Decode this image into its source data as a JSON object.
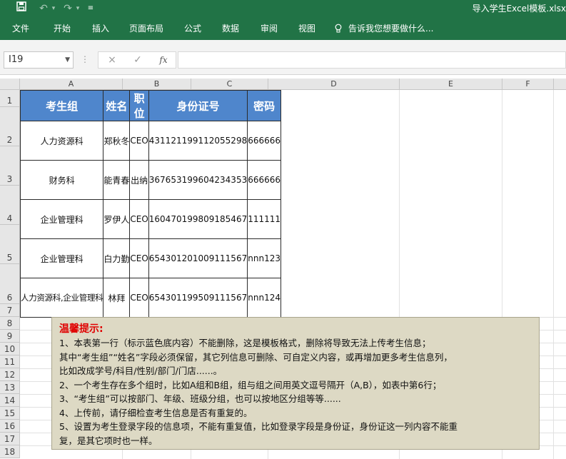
{
  "window": {
    "title": "导入学生Excel模板.xlsx"
  },
  "quick_access": {
    "icons": [
      "save-icon",
      "undo-icon",
      "redo-icon",
      "customize-icon"
    ]
  },
  "ribbon": {
    "tabs": [
      "文件",
      "开始",
      "插入",
      "页面布局",
      "公式",
      "数据",
      "审阅",
      "视图"
    ],
    "tell_me": "告诉我您想要做什么..."
  },
  "formula_bar": {
    "name_box": "I19",
    "cancel": "×",
    "enter": "✓",
    "fx": "fx",
    "value": ""
  },
  "columns": [
    "A",
    "B",
    "C",
    "D",
    "E",
    "F"
  ],
  "rows": [
    "1",
    "2",
    "3",
    "4",
    "5",
    "6",
    "7",
    "8",
    "9",
    "10",
    "11",
    "12",
    "13",
    "14",
    "15",
    "16",
    "17",
    "18"
  ],
  "table": {
    "headers": [
      "考生组",
      "姓名",
      "职位",
      "身份证号",
      "密码"
    ],
    "rows": [
      [
        "人力资源科",
        "郑秋冬",
        "CEO",
        "431121199112055298",
        "666666"
      ],
      [
        "财务科",
        "能青春",
        "出纳",
        "367653199604234353",
        "666666"
      ],
      [
        "企业管理科",
        "罗伊人",
        "CEO",
        "160470199809185467",
        "111111"
      ],
      [
        "企业管理科",
        "白力勤",
        "CEO",
        "654301201009111567",
        "nnn123"
      ],
      [
        "人力资源科,企业管理科",
        "林拜",
        "CEO",
        "654301199509111567",
        "nnn124"
      ]
    ]
  },
  "tips": {
    "title": "温馨提示:",
    "lines": [
      "1、本表第一行（标示蓝色底内容）不能删除，这是模板格式，删除将导致无法上传考生信息；",
      "其中“考生组”“姓名”字段必须保留，其它列信息可删除、可自定义内容，或再增加更多考生信息列，",
      "比如改成学号/科目/性别/部门/门店......。",
      "2、一个考生存在多个组时，比如A组和B组，组与组之间用英文逗号隔开（A,B），如表中第6行；",
      "3、“考生组”可以按部门、年级、班级分组，也可以按地区分组等等......",
      "4、上传前，请仔细检查考生信息是否有重复的。",
      "5、设置为考生登录字段的信息项，不能有重复值，比如登录字段是身份证，身份证这一列内容不能重",
      "复，是其它项时也一样。"
    ]
  },
  "colors": {
    "ribbon": "#217346",
    "header_fill": "#4f86cc",
    "tip_fill": "#ddd9c4",
    "tip_title": "#e00000"
  }
}
